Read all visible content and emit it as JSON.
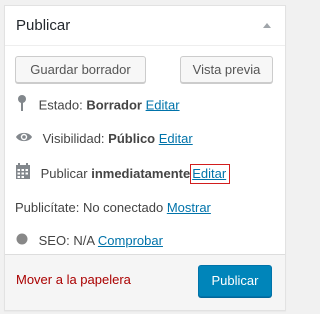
{
  "panel": {
    "title": "Publicar"
  },
  "buttons": {
    "save_draft": "Guardar borrador",
    "preview": "Vista previa",
    "publish": "Publicar"
  },
  "status": {
    "label": "Estado:",
    "value": "Borrador",
    "edit": "Editar",
    "icon": "pin-icon"
  },
  "visibility": {
    "label": "Visibilidad:",
    "value": "Público",
    "edit": "Editar",
    "icon": "eye-icon"
  },
  "schedule": {
    "label": "Publicar",
    "value": "inmediatamente",
    "edit": "Editar",
    "icon": "calendar-icon"
  },
  "publicize": {
    "label": "Publicítate:",
    "value": "No conectado",
    "action": "Mostrar"
  },
  "seo": {
    "label": "SEO:",
    "value": "N/A",
    "action": "Comprobar",
    "icon": "status-dot-icon"
  },
  "footer": {
    "trash_label": "Mover a la papelera"
  },
  "colors": {
    "link": "#0073aa",
    "trash": "#a00",
    "publish_bg": "#0085ba",
    "highlight_border": "#d21d1d"
  }
}
